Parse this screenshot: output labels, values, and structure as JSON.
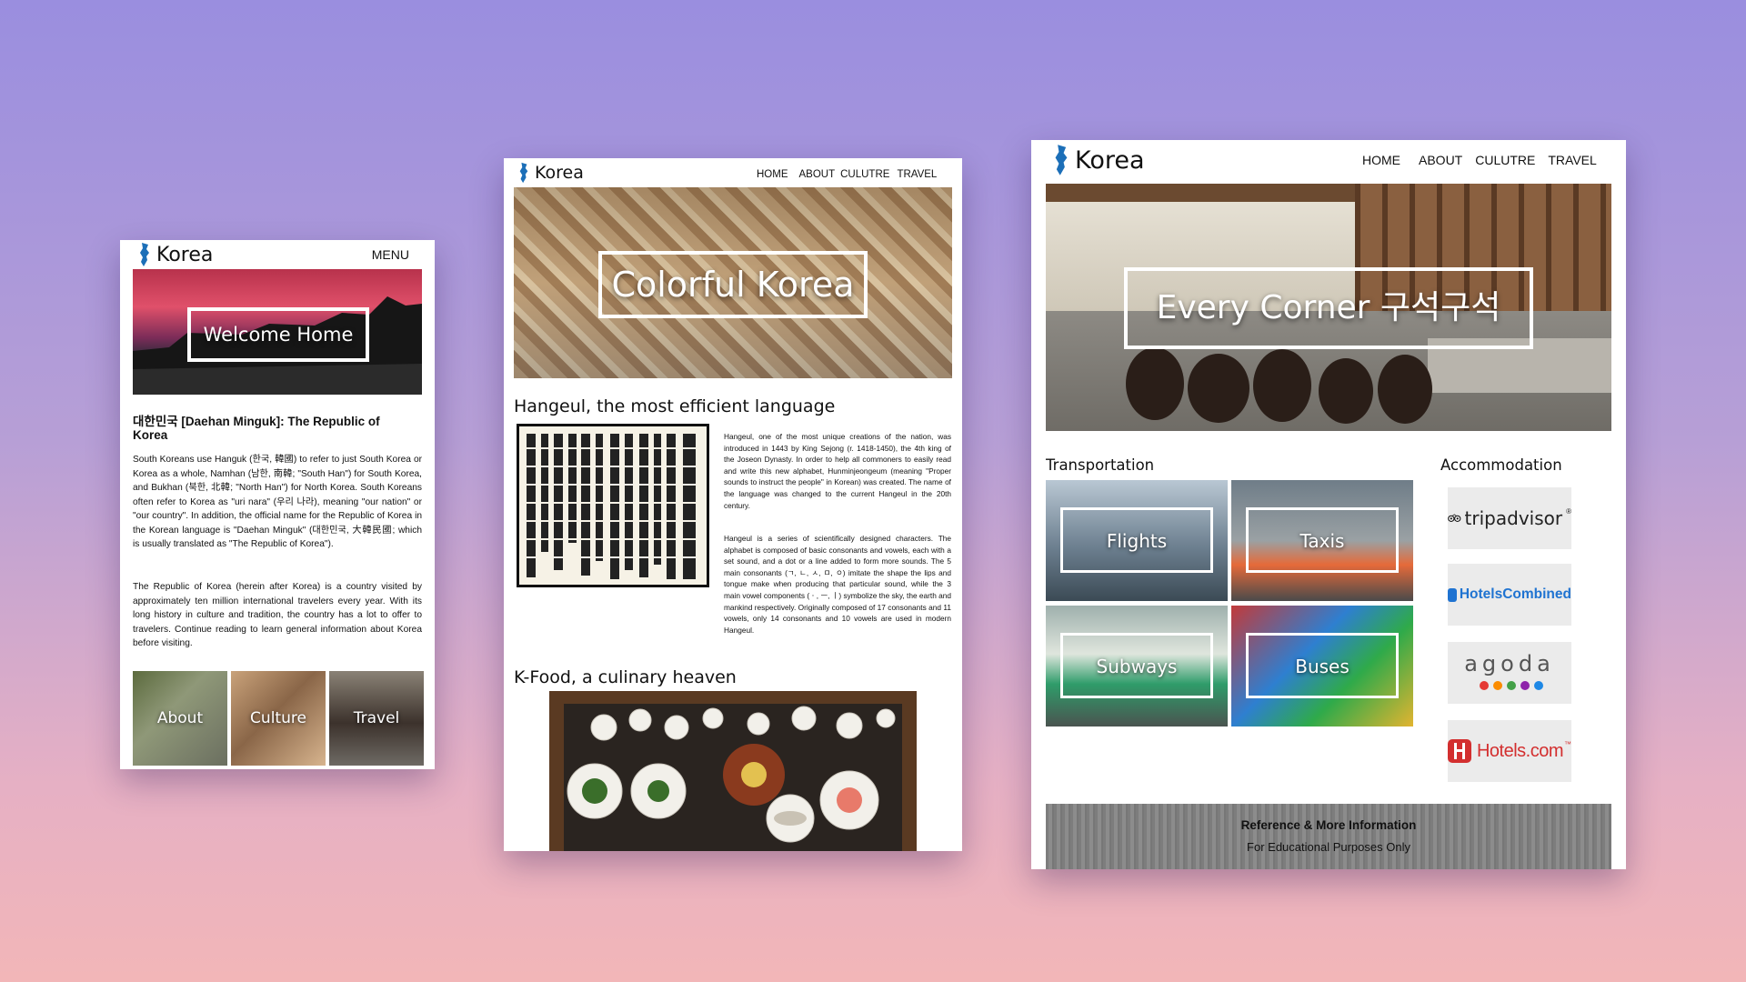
{
  "brand": "Korea",
  "mobile": {
    "menu": "MENU",
    "hero_title": "Welcome Home",
    "heading": "대한민국 [Daehan Minguk]: The Republic of Korea",
    "para1": "South Koreans use Hanguk (한국, 韓國) to refer to just South Korea or Korea as a whole, Namhan (남한, 南韓; \"South Han\") for South Korea, and Bukhan (북한, 北韓; \"North Han\") for North Korea. South Koreans often refer to Korea as \"uri nara\" (우리 나라), meaning \"our nation\" or \"our country\". In addition, the official name for the Republic of Korea in the Korean language is \"Daehan Minguk\" (대한민국, 大韓民國; which is usually translated as \"The Republic of Korea\").",
    "para2": "The Republic of Korea (herein after Korea) is a country visited by approximately ten million international travelers every year. With its long history in culture and tradition, the country has a lot to offer to travelers. Continue reading to learn general information about Korea before visiting.",
    "tiles": [
      "About",
      "Culture",
      "Travel"
    ]
  },
  "tablet": {
    "nav": [
      "HOME",
      "ABOUT",
      "CULUTRE",
      "TRAVEL"
    ],
    "hero_title": "Colorful Korea",
    "section1_title": "Hangeul, the most efficient language",
    "hangeul_p1": "Hangeul, one of the most unique creations of the nation, was introduced in 1443 by King Sejong (r. 1418-1450), the 4th king of the Joseon Dynasty. In order to help all commoners to easily read and write this new alphabet, Hunminjeongeum (meaning \"Proper sounds to instruct the people\" in Korean) was created. The name of the language was changed to the current Hangeul in the 20th century.",
    "hangeul_p2": "Hangeul is a series of scientifically designed characters. The alphabet is composed of basic consonants and vowels, each with a set sound, and a dot or a line added to form more sounds. The 5 main consonants (ㄱ, ㄴ, ㅅ, ㅁ, ㅇ) imitate the shape the lips and tongue make when producing that particular sound, while the 3 main vowel components (ㆍ, ㅡ, ㅣ) symbolize the sky, the earth and mankind respectively. Originally composed of 17 consonants and 11 vowels, only 14 consonants and 10 vowels are used in modern Hangeul.",
    "section2_title": "K-Food, a culinary heaven"
  },
  "desktop": {
    "nav": [
      "HOME",
      "ABOUT",
      "CULUTRE",
      "TRAVEL"
    ],
    "hero_title": "Every Corner 구석구석",
    "transport_title": "Transportation",
    "accommodation_title": "Accommodation",
    "transport_tiles": [
      "Flights",
      "Taxis",
      "Subways",
      "Buses"
    ],
    "accommodation": [
      "tripadvisor",
      "HotelsCombined",
      "agoda",
      "Hotels.com"
    ],
    "tm": "™",
    "reg": "®",
    "footer_line1": "Reference & More Information",
    "footer_line2": "For Educational Purposes Only"
  },
  "colors": {
    "logo_blue": "#1c6fb8",
    "background_top": "#9a8edf",
    "background_bottom": "#f2b6b8",
    "hotelscombined_blue": "#1f73d1",
    "hotelsdotcom_red": "#d32f2f"
  }
}
